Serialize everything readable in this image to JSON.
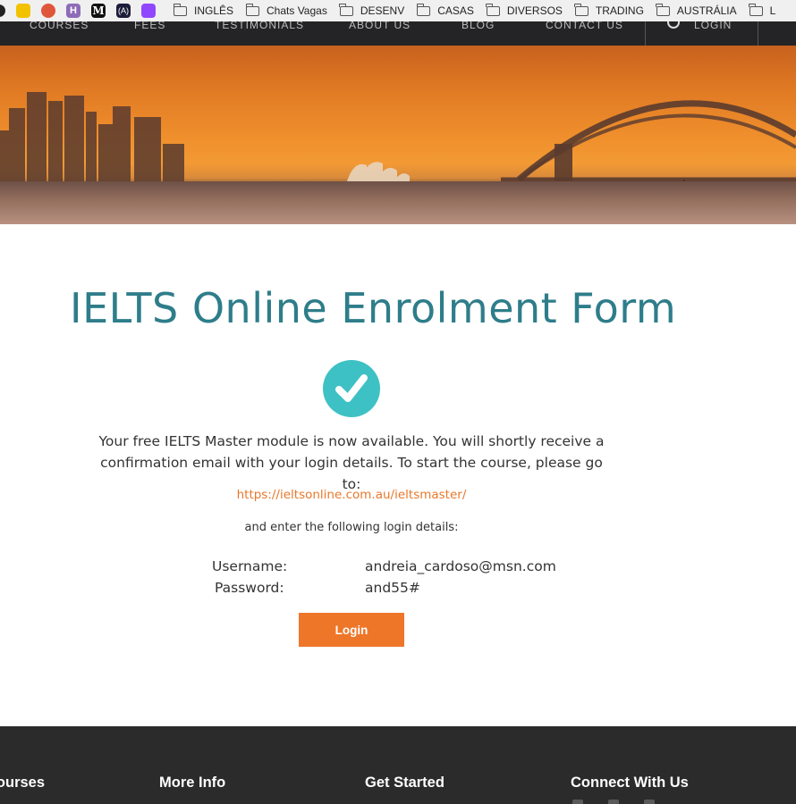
{
  "browser": {
    "bookmarks": {
      "favicon_icons": [
        "dark-circle-icon",
        "smiley-yellow-icon",
        "colorful-circle-icon",
        "h-purple-icon",
        "medium-m-icon",
        "code-bracket-icon",
        "twitch-icon"
      ],
      "favicon_letters": {
        "h": "H",
        "medium": "M",
        "code": "(A)"
      },
      "folders": [
        "INGLÊS",
        "Chats Vagas",
        "DESENV",
        "CASAS",
        "DIVERSOS",
        "TRADING",
        "AUSTRÁLIA",
        "L"
      ]
    }
  },
  "site_nav": {
    "items": [
      "COURSES",
      "FEES",
      "TESTIMONIALS",
      "ABOUT US",
      "BLOG",
      "CONTACT US"
    ],
    "login_label": "LOGIN"
  },
  "main": {
    "title": "IELTS Online Enrolment Form",
    "success_message": "Your free IELTS Master module is now available. You will shortly receive a confirmation email with your login details. To start the course, please go to:",
    "course_link": "https://ieltsonline.com.au/ieltsmaster/",
    "instructions": "and enter the following login details:",
    "credentials": {
      "username_label": "Username:",
      "username_value": "andreia_cardoso@msn.com",
      "password_label": "Password:",
      "password_value": "and55#"
    },
    "login_button": "Login"
  },
  "footer": {
    "headings": {
      "courses": "Courses",
      "more_info": "More Info",
      "get_started": "Get Started",
      "connect": "Connect With Us"
    }
  },
  "colors": {
    "title": "#2e7d8a",
    "check_circle": "#3ec1c4",
    "link": "#e8782b",
    "button": "#ee7629",
    "footer_bg": "#2b2b2b",
    "nav_bg": "#242426"
  }
}
